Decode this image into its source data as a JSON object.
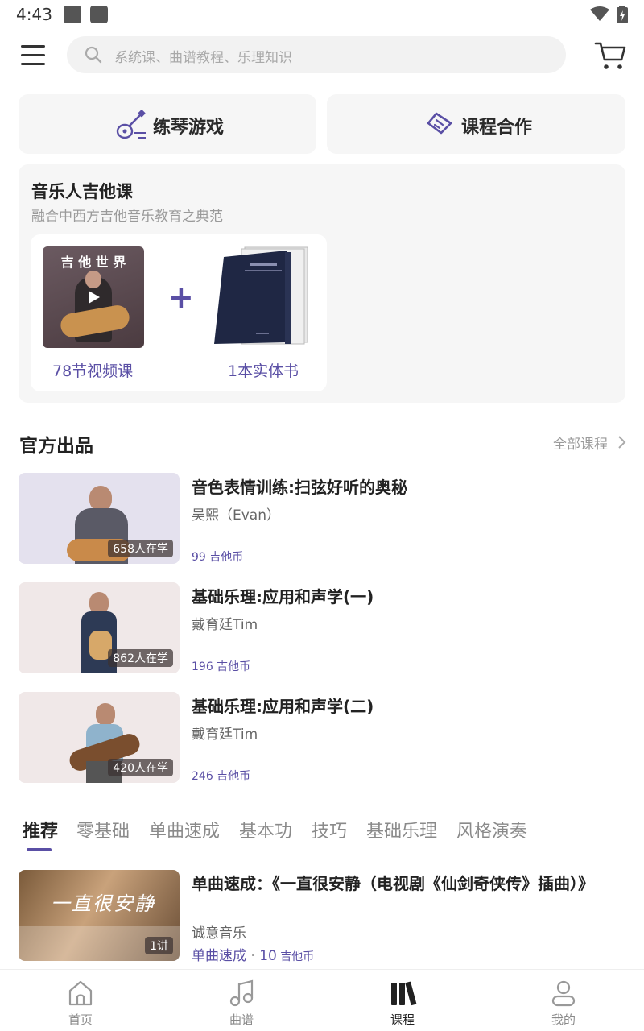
{
  "status_bar": {
    "time": "4:43"
  },
  "search": {
    "placeholder": "系统课、曲谱教程、乐理知识"
  },
  "quick_cards": [
    {
      "label": "练琴游戏",
      "icon": "guitar-icon"
    },
    {
      "label": "课程合作",
      "icon": "handshake-icon"
    }
  ],
  "banner": {
    "title": "音乐人吉他课",
    "subtitle": "融合中西方吉他音乐教育之典范",
    "video_thumb_text": "吉 他 世 界",
    "video_label": "78节视频课",
    "book_label": "1本实体书"
  },
  "official": {
    "title": "官方出品",
    "more_label": "全部课程",
    "courses": [
      {
        "title": "音色表情训练:扫弦好听的奥秘",
        "teacher": "吴熙（Evan）",
        "learners": "658人在学",
        "price": "99 吉他币"
      },
      {
        "title": "基础乐理:应用和声学(一)",
        "teacher": "戴育廷Tim",
        "learners": "862人在学",
        "price": "196 吉他币"
      },
      {
        "title": "基础乐理:应用和声学(二)",
        "teacher": "戴育廷Tim",
        "learners": "420人在学",
        "price": "246 吉他币"
      }
    ]
  },
  "tabs": [
    "推荐",
    "零基础",
    "单曲速成",
    "基本功",
    "技巧",
    "基础乐理",
    "风格演奏"
  ],
  "recommended": {
    "title": "单曲速成：《一直很安静（电视剧《仙剑奇侠传》插曲）》",
    "thumb_text": "一直很安静",
    "author": "诚意音乐",
    "category": "单曲速成",
    "separator": " · ",
    "price_value": "10",
    "price_unit": " 吉他币",
    "lessons": "1讲"
  },
  "bottom_nav": [
    {
      "label": "首页",
      "icon": "home-icon"
    },
    {
      "label": "曲谱",
      "icon": "music-note-icon"
    },
    {
      "label": "课程",
      "icon": "books-icon"
    },
    {
      "label": "我的",
      "icon": "profile-icon"
    }
  ],
  "colors": {
    "accent": "#5a4fa5",
    "card_bg": "#f6f6f6",
    "text_primary": "#222222",
    "text_secondary": "#9a9a9a"
  }
}
